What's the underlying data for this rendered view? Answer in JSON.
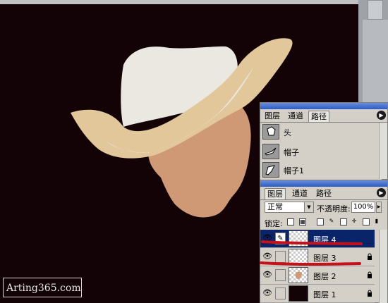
{
  "watermark": "Arting365.com",
  "paths_panel": {
    "tabs": [
      "图层",
      "通道",
      "路径"
    ],
    "active_tab": 2,
    "paths": [
      {
        "name": "头"
      },
      {
        "name": "帽子"
      },
      {
        "name": "帽子1"
      }
    ]
  },
  "layers_panel": {
    "tabs": [
      "图层",
      "通道",
      "路径"
    ],
    "active_tab": 0,
    "blend_mode": "正常",
    "opacity_label": "不透明度:",
    "opacity_value": "100%",
    "lock_label": "锁定:",
    "layers": [
      {
        "name": "图层 4",
        "selected": true,
        "locked": false
      },
      {
        "name": "图层 3",
        "selected": false,
        "locked": true
      },
      {
        "name": "图层 2",
        "selected": false,
        "locked": true
      },
      {
        "name": "图层 1",
        "selected": false,
        "locked": true
      }
    ]
  },
  "colors": {
    "canvas_bg": "#130306",
    "hat_top": "#ebe7e1",
    "hat_brim": "#e2c79b",
    "face": "#d09975",
    "red_annotation": "#c8101a",
    "selection_blue": "#0a246a"
  }
}
